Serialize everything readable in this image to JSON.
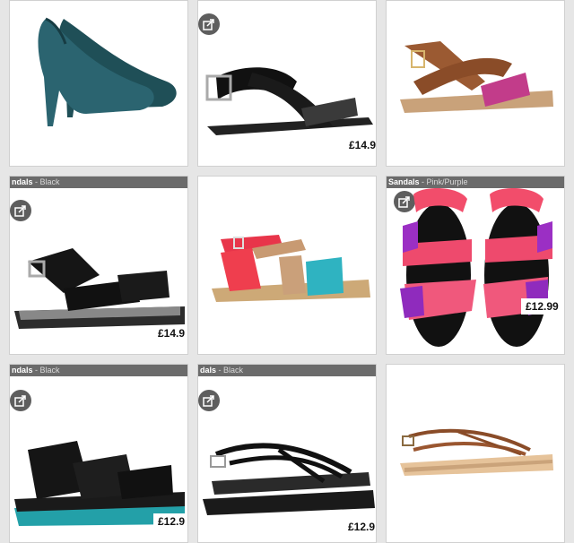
{
  "products": [
    {
      "caption_name": "",
      "caption_color": "",
      "price": ""
    },
    {
      "caption_name": "",
      "caption_color": "",
      "price": "£14.9"
    },
    {
      "caption_name": "",
      "caption_color": "",
      "price": ""
    },
    {
      "caption_name": "ndals",
      "caption_color": " - Black",
      "price": "£14.9"
    },
    {
      "caption_name": "",
      "caption_color": "",
      "price": ""
    },
    {
      "caption_name": "Sandals",
      "caption_color": " - Pink/Purple",
      "price": "£12.99"
    },
    {
      "caption_name": "ndals",
      "caption_color": " - Black",
      "price": "£12.9"
    },
    {
      "caption_name": "dals",
      "caption_color": " - Black",
      "price": "£12.9"
    },
    {
      "caption_name": "",
      "caption_color": "",
      "price": ""
    }
  ],
  "icons": {
    "share": "share-icon"
  },
  "colors": {
    "caption_bar": "#6b6b6b",
    "share_badge": "#5e5e5e",
    "background": "#e6e6e6"
  }
}
